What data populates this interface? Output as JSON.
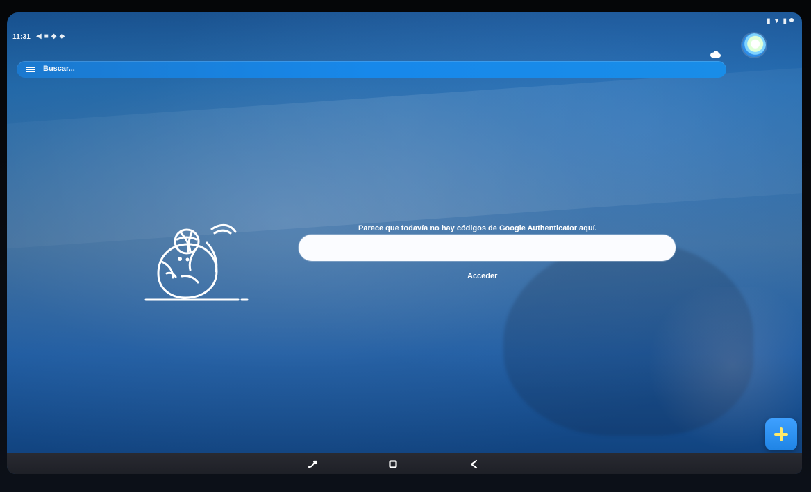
{
  "status_bar": {
    "time": "11:31",
    "left_icons": [
      "notification-icon",
      "notification-icon",
      "notification-icon",
      "notification-icon"
    ],
    "right_icons": [
      "signal-icon",
      "wifi-icon",
      "battery-icon"
    ]
  },
  "search": {
    "placeholder": "Buscar..."
  },
  "empty_state": {
    "message": "Parece que todavía no hay códigos de Google Authenticator aquí.",
    "action_label": "Acceder"
  },
  "icons": {
    "menu": "menu-icon",
    "cloud": "cloud-icon",
    "avatar": "avatar",
    "add": "plus-icon",
    "recent": "recent-apps-icon",
    "home": "home-icon",
    "back": "back-icon"
  },
  "colors": {
    "accent": "#1788ea",
    "surface": "#fbfcff",
    "nav_background": "#22242b"
  }
}
